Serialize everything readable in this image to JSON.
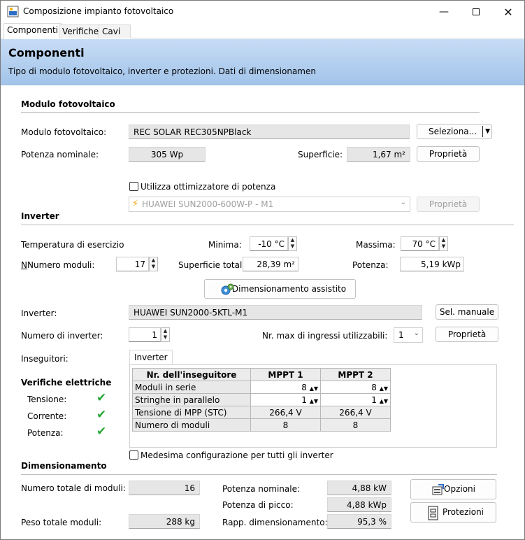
{
  "window": {
    "title": "Composizione impianto fotovoltaico"
  },
  "tabs": [
    "Componenti",
    "Verifiche",
    "Cavi"
  ],
  "banner": {
    "title": "Componenti",
    "subtitle": "Tipo di modulo fotovoltaico, inverter e protezioni. Dati di dimensionamen"
  },
  "modulo": {
    "section": "Modulo fotovoltaico",
    "label": "Modulo fotovoltaico:",
    "value": "REC SOLAR REC305NPBlack",
    "select_btn": "Seleziona...",
    "potenza_label": "Potenza nominale:",
    "potenza_value": "305 Wp",
    "superficie_label": "Superficie:",
    "superficie_value": "1,67 m²",
    "proprieta_btn": "Proprietà",
    "ottimizzatore_label": "Utilizza ottimizzatore di potenza",
    "ottimizzatore_value": "HUAWEI SUN2000-600W-P -  M1",
    "ottimizzatore_btn": "Proprietà"
  },
  "inverter": {
    "section": "Inverter",
    "temp_label": "Temperatura di esercizio",
    "minima_label": "Minima:",
    "minima_value": "-10 °C",
    "massima_label": "Massima:",
    "massima_value": "70 °C",
    "num_moduli_label": "Numero moduli:",
    "num_moduli_value": "17",
    "superficie_tot_label": "Superficie totale:",
    "superficie_tot_value": "28,39 m²",
    "potenza_label": "Potenza:",
    "potenza_value": "5,19 kWp",
    "dimensionamento_btn": "Dimensionamento assistito",
    "inverter_label": "Inverter:",
    "inverter_value": "HUAWEI SUN2000-5KTL-M1",
    "sel_manuale_btn": "Sel. manuale",
    "num_inverter_label": "Numero di inverter:",
    "num_inverter_value": "1",
    "max_ingressi_label": "Nr. max di ingressi utilizzabili:",
    "max_ingressi_value": "1",
    "proprieta_btn": "Proprietà",
    "inseguitori_label": "Inseguitori:",
    "inseguitori_tab": "Inverter"
  },
  "mppt_table": {
    "headers": [
      "Nr. dell'inseguitore",
      "MPPT 1",
      "MPPT 2"
    ],
    "rows": [
      {
        "label": "Moduli in serie",
        "v1": "8",
        "v2": "8"
      },
      {
        "label": "Stringhe in parallelo",
        "v1": "1",
        "v2": "1"
      },
      {
        "label": "Tensione di MPP (STC)",
        "v1": "266,4 V",
        "v2": "266,4 V"
      },
      {
        "label": "Numero di moduli",
        "v1": "8",
        "v2": "8"
      }
    ]
  },
  "verifiche": {
    "title": "Verifiche elettriche",
    "tensione": "Tensione:",
    "corrente": "Corrente:",
    "potenza": "Potenza:"
  },
  "medesima_label": "Medesima configurazione per tutti gli inverter",
  "dimensionamento": {
    "section": "Dimensionamento",
    "num_tot_label": "Numero totale di moduli:",
    "num_tot_value": "16",
    "peso_label": "Peso totale moduli:",
    "peso_value": "288 kg",
    "pot_nom_label": "Potenza nominale:",
    "pot_nom_value": "4,88 kW",
    "pot_picco_label": "Potenza di picco:",
    "pot_picco_value": "4,88 kWp",
    "rapp_label": "Rapp. dimensionamento:",
    "rapp_value": "95,3 %",
    "opzioni_btn": "Opzioni",
    "protezioni_btn": "Protezioni"
  }
}
